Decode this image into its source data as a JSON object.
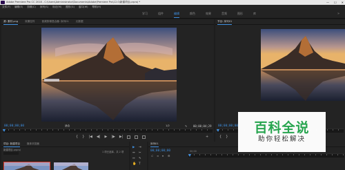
{
  "window": {
    "title": "Adobe Premiere Pro CC 2018 - C:\\Users\\Administrator\\Documents\\Adobe\\Premiere Pro\\12.0\\新建项目.prproj *",
    "minimize": "—",
    "maximize": "☐",
    "close": "✕"
  },
  "menubar": {
    "items": [
      "文件(F)",
      "编辑(E)",
      "剪辑(C)",
      "序列(S)",
      "标记(M)",
      "图形(G)",
      "窗口(W)",
      "帮助(H)"
    ]
  },
  "workspaces": {
    "items": [
      "学习",
      "组件",
      "编辑",
      "颜色",
      "效果",
      "音频",
      "图形",
      "库"
    ],
    "active_index": 2,
    "more": "»"
  },
  "source": {
    "tabs": [
      "源: 素材.png",
      "效果控件",
      "音频剪辑混合器: 序列01",
      "元数据"
    ],
    "active_tab": 0,
    "timecode": "00;00;00;00",
    "fit": "适合",
    "ratio": "1/2",
    "duration": "00;00;04;29",
    "transport": [
      "{",
      "}",
      "|◀",
      "◀|",
      "▶",
      "|▶",
      "▶|"
    ]
  },
  "program": {
    "tabs": [
      "节目: 序列01"
    ],
    "active_tab": 0,
    "timecode": "00;00;00;00"
  },
  "project": {
    "tabs": [
      "项目: 新建项目",
      "媒体浏览器"
    ],
    "active_tab": 0,
    "filename": "新建项目.prproj",
    "count": "1 项已选择，共 2 项"
  },
  "timeline": {
    "tab": "序列01",
    "timecode": "00;00;00;00",
    "ruler": [
      "00;00",
      "00;00;04;29"
    ]
  },
  "watermark": {
    "title": "百科全说",
    "subtitle": "助你轻松解决"
  }
}
